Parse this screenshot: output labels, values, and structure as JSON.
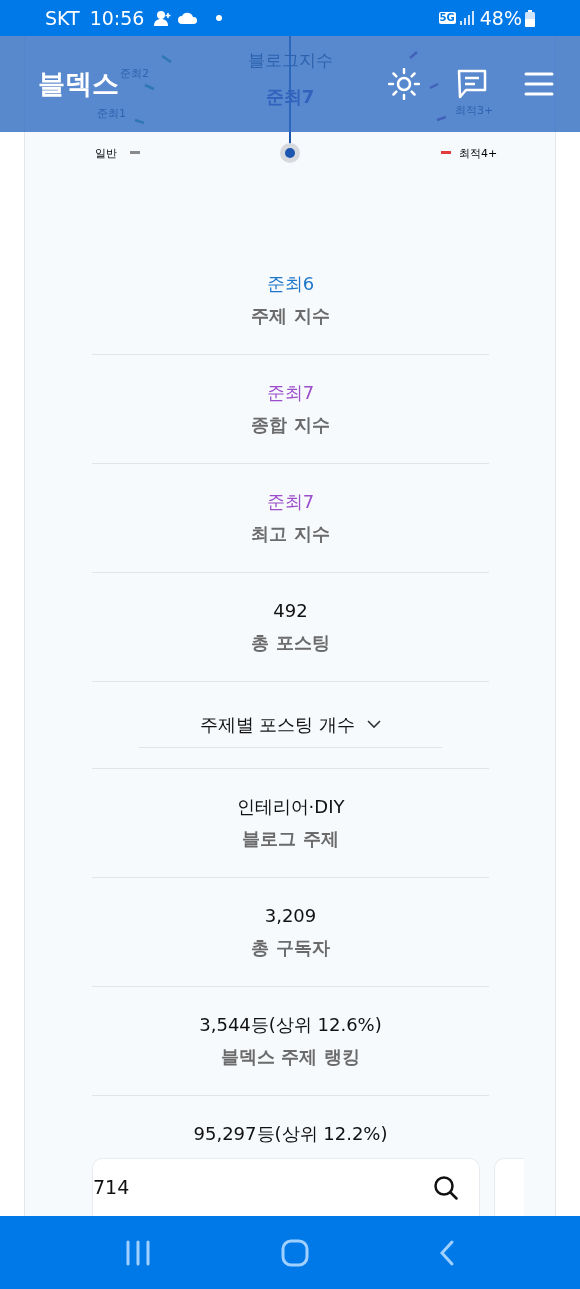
{
  "status_bar": {
    "carrier": "SKT",
    "time": "10:56",
    "network": "5G",
    "battery": "48%"
  },
  "header": {
    "logo": "블덱스"
  },
  "gauge": {
    "title": "블로그지수",
    "value": "준최7",
    "scale_labels": [
      {
        "text": "준최2"
      },
      {
        "text": "준최1"
      },
      {
        "text": "최적3+"
      },
      {
        "text": "일반",
        "color": "#8a8a8a"
      },
      {
        "text": "최적4+",
        "color": "#e23b3b"
      }
    ]
  },
  "stats": [
    {
      "kind": "stat",
      "value": "준최6",
      "label": "주제 지수",
      "color": "#1f77c9"
    },
    {
      "kind": "stat",
      "value": "준최7",
      "label": "종합 지수",
      "color": "#9b4dca"
    },
    {
      "kind": "stat",
      "value": "준최7",
      "label": "최고 지수",
      "color": "#9b4dca"
    },
    {
      "kind": "stat",
      "value": "492",
      "label": "총 포스팅"
    },
    {
      "kind": "dropdown",
      "label": "주제별 포스팅 개수",
      "expanded": false
    },
    {
      "kind": "stat",
      "value": "인테리어·DIY",
      "label": "블로그 주제"
    },
    {
      "kind": "stat",
      "value": "3,209",
      "label": "총 구독자"
    },
    {
      "kind": "stat",
      "value": "3,544등(상위 12.6%)",
      "label": "블덱스 주제 랭킹"
    },
    {
      "kind": "stat",
      "value": "95,297등(상위 12.2%)"
    }
  ],
  "search": {
    "value": "714"
  }
}
